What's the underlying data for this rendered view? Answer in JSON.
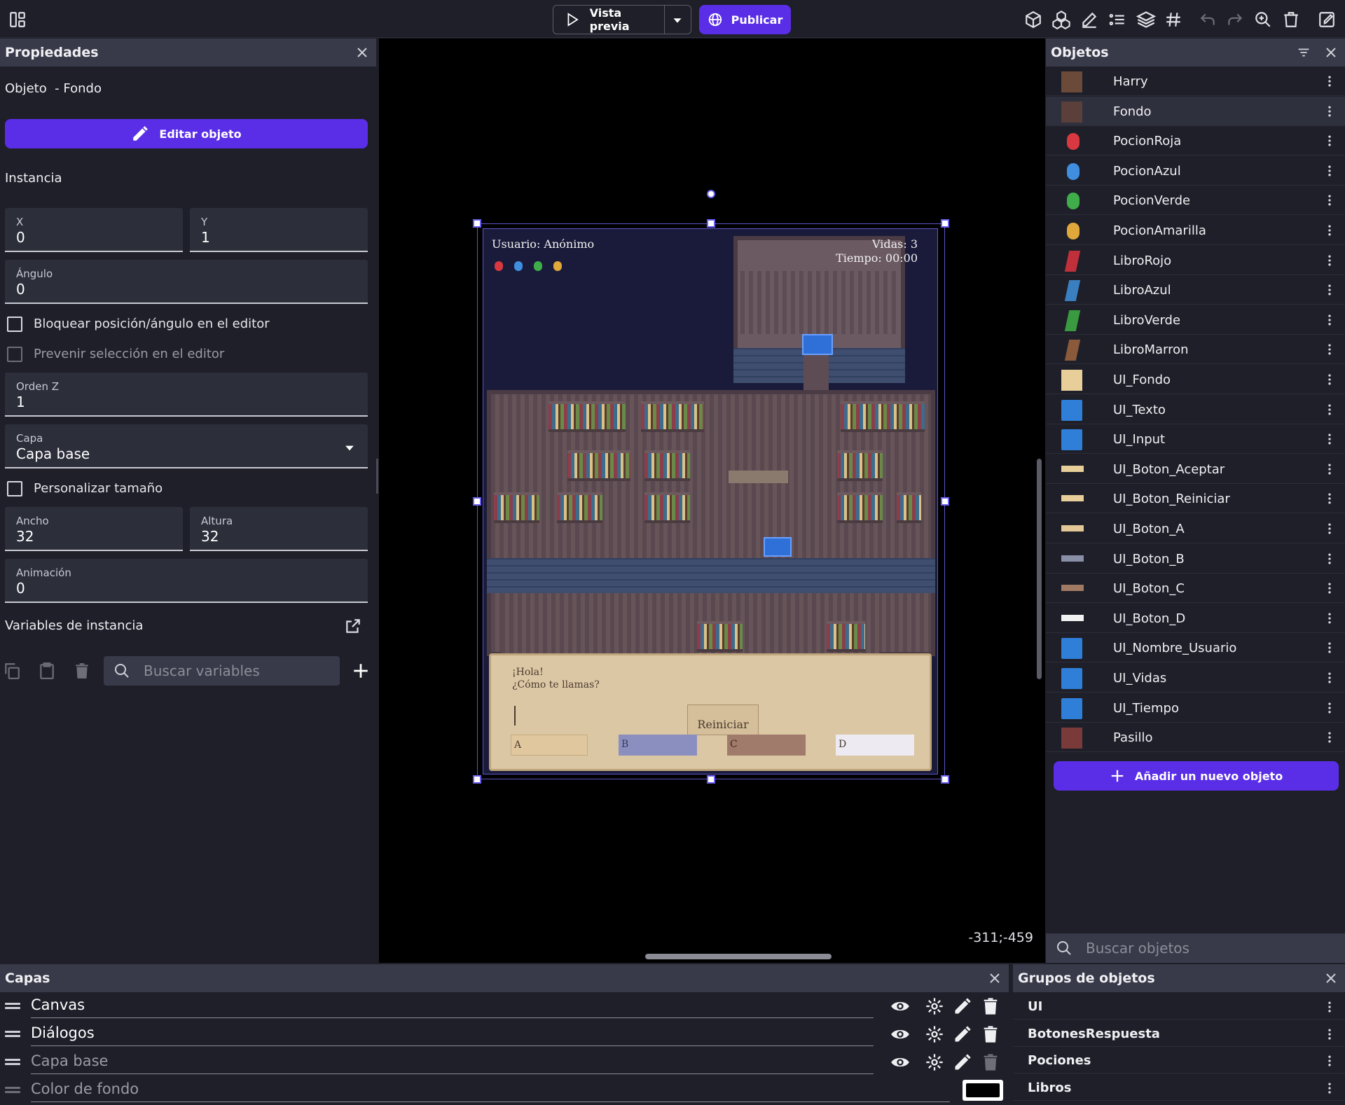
{
  "toolbar": {
    "preview_label": "Vista previa",
    "publish_label": "Publicar"
  },
  "properties": {
    "title": "Propiedades",
    "object_line": "Objeto  - Fondo",
    "edit_object_label": "Editar objeto",
    "instance_heading": "Instancia",
    "x_label": "X",
    "x_value": "0",
    "y_label": "Y",
    "y_value": "1",
    "angle_label": "Ángulo",
    "angle_value": "0",
    "lock_label": "Bloquear posición/ángulo en el editor",
    "prevent_label": "Prevenir selección en el editor",
    "z_label": "Orden Z",
    "z_value": "1",
    "layer_label": "Capa",
    "layer_value": "Capa base",
    "custom_size_label": "Personalizar tamaño",
    "width_label": "Ancho",
    "width_value": "32",
    "height_label": "Altura",
    "height_value": "32",
    "animation_label": "Animación",
    "animation_value": "0",
    "variables_heading": "Variables de instancia",
    "search_variables_placeholder": "Buscar variables"
  },
  "canvas": {
    "coords": "-311;-459",
    "game": {
      "user_text": "Usuario: Anónimo",
      "lives_text": "Vidas: 3",
      "time_text": "Tiempo: 00:00",
      "greeting_1": "¡Hola!",
      "greeting_2": "¿Cómo te llamas?",
      "restart_label": "Reiniciar",
      "answer_a": "A",
      "answer_b": "B",
      "answer_c": "C",
      "answer_d": "D"
    }
  },
  "objects": {
    "title": "Objetos",
    "add_label": "Añadir un nuevo objeto",
    "search_placeholder": "Buscar objetos",
    "items": [
      {
        "name": "Harry",
        "icon": "character-sprite-icon",
        "color": "#6b4a3a"
      },
      {
        "name": "Fondo",
        "icon": "background-tile-icon",
        "color": "#5a3f3a"
      },
      {
        "name": "PocionRoja",
        "icon": "red-potion-icon",
        "color": "#d8383f"
      },
      {
        "name": "PocionAzul",
        "icon": "blue-potion-icon",
        "color": "#3f8ee0"
      },
      {
        "name": "PocionVerde",
        "icon": "green-potion-icon",
        "color": "#3fae4a"
      },
      {
        "name": "PocionAmarilla",
        "icon": "yellow-potion-icon",
        "color": "#e0a83a"
      },
      {
        "name": "LibroRojo",
        "icon": "red-book-icon",
        "color": "#c0303a"
      },
      {
        "name": "LibroAzul",
        "icon": "blue-book-icon",
        "color": "#3a7fc0"
      },
      {
        "name": "LibroVerde",
        "icon": "green-book-icon",
        "color": "#3a9a40"
      },
      {
        "name": "LibroMarron",
        "icon": "brown-book-icon",
        "color": "#8a5a3a"
      },
      {
        "name": "UI_Fondo",
        "icon": "parchment-icon",
        "color": "#e8cf9a"
      },
      {
        "name": "UI_Texto",
        "icon": "bitmap-text-icon",
        "color": "#2f7fd8"
      },
      {
        "name": "UI_Input",
        "icon": "text-input-icon",
        "color": "#2f7fd8"
      },
      {
        "name": "UI_Boton_Aceptar",
        "icon": "button-bar-icon",
        "color": "#e8cf9a"
      },
      {
        "name": "UI_Boton_Reiniciar",
        "icon": "button-bar-icon",
        "color": "#e8cf9a"
      },
      {
        "name": "UI_Boton_A",
        "icon": "button-bar-icon",
        "color": "#e3c796"
      },
      {
        "name": "UI_Boton_B",
        "icon": "button-bar-icon",
        "color": "#8a8fa8"
      },
      {
        "name": "UI_Boton_C",
        "icon": "button-bar-icon",
        "color": "#a07a62"
      },
      {
        "name": "UI_Boton_D",
        "icon": "button-bar-icon",
        "color": "#f2f2f2"
      },
      {
        "name": "UI_Nombre_Usuario",
        "icon": "bitmap-text-icon",
        "color": "#2f7fd8"
      },
      {
        "name": "UI_Vidas",
        "icon": "bitmap-text-icon",
        "color": "#2f7fd8"
      },
      {
        "name": "UI_Tiempo",
        "icon": "bitmap-text-icon",
        "color": "#2f7fd8"
      },
      {
        "name": "Pasillo",
        "icon": "corridor-tile-icon",
        "color": "#7a3a3a"
      }
    ]
  },
  "layers": {
    "title": "Capas",
    "items": [
      {
        "name": "Canvas"
      },
      {
        "name": "Diálogos"
      },
      {
        "name": "Capa base"
      },
      {
        "name": "Color de fondo"
      }
    ]
  },
  "groups": {
    "title": "Grupos de objetos",
    "items": [
      {
        "name": "UI"
      },
      {
        "name": "BotonesRespuesta"
      },
      {
        "name": "Pociones"
      },
      {
        "name": "Libros"
      }
    ]
  },
  "colors": {
    "accent": "#5a2ee6",
    "panel_bg": "#1e1f29",
    "header_bg": "#383a4a",
    "scene_bg": "#000000"
  }
}
